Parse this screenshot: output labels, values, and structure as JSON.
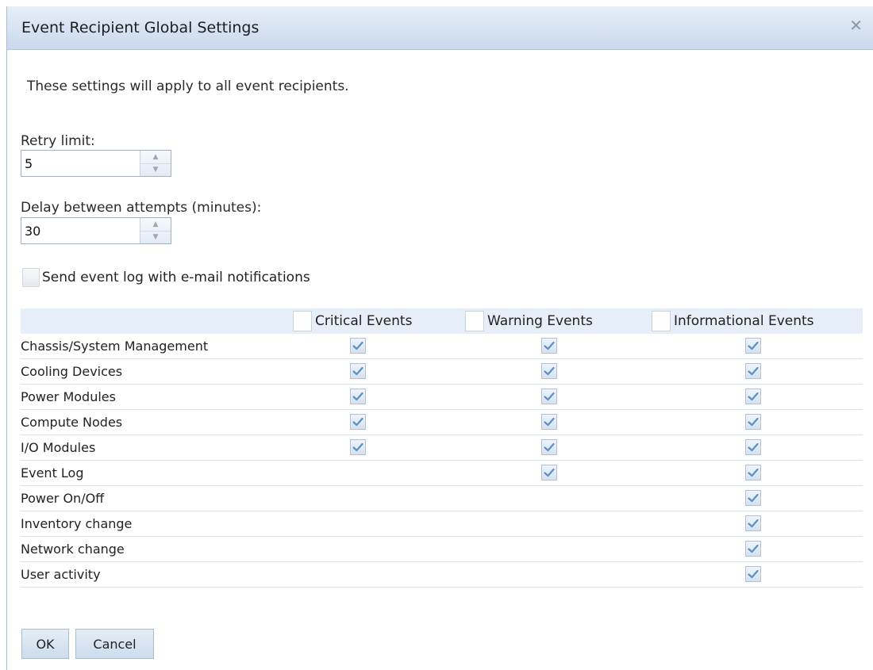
{
  "dialog": {
    "title": "Event Recipient Global Settings",
    "close_icon": "close-icon",
    "intro": "These settings will apply to all event recipients."
  },
  "retry": {
    "label": "Retry limit:",
    "value": "5"
  },
  "delay": {
    "label": "Delay between attempts (minutes):",
    "value": "30"
  },
  "send_log": {
    "label": "Send event log with e-mail notifications",
    "checked": false
  },
  "table": {
    "columns": [
      {
        "label": "Critical Events",
        "checked": false
      },
      {
        "label": "Warning Events",
        "checked": false
      },
      {
        "label": "Informational Events",
        "checked": false
      }
    ],
    "rows": [
      {
        "label": "Chassis/System Management",
        "critical": true,
        "warning": true,
        "informational": true
      },
      {
        "label": "Cooling Devices",
        "critical": true,
        "warning": true,
        "informational": true
      },
      {
        "label": "Power Modules",
        "critical": true,
        "warning": true,
        "informational": true
      },
      {
        "label": "Compute Nodes",
        "critical": true,
        "warning": true,
        "informational": true
      },
      {
        "label": "I/O Modules",
        "critical": true,
        "warning": true,
        "informational": true
      },
      {
        "label": "Event Log",
        "critical": null,
        "warning": true,
        "informational": true
      },
      {
        "label": "Power On/Off",
        "critical": null,
        "warning": null,
        "informational": true
      },
      {
        "label": "Inventory change",
        "critical": null,
        "warning": null,
        "informational": true
      },
      {
        "label": "Network change",
        "critical": null,
        "warning": null,
        "informational": true
      },
      {
        "label": "User activity",
        "critical": null,
        "warning": null,
        "informational": true
      }
    ]
  },
  "buttons": {
    "ok": "OK",
    "cancel": "Cancel"
  },
  "colors": {
    "titlebar": "#c9d9ec",
    "checkmark": "#5b8fc7",
    "accent": "#a9bdd2"
  }
}
